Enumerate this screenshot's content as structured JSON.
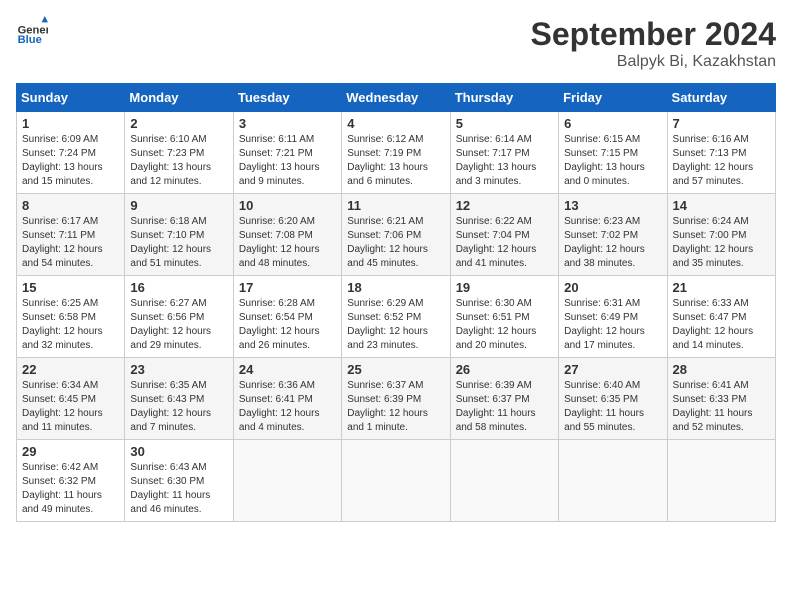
{
  "header": {
    "logo_general": "General",
    "logo_blue": "Blue",
    "month": "September 2024",
    "location": "Balpyk Bi, Kazakhstan"
  },
  "days_of_week": [
    "Sunday",
    "Monday",
    "Tuesday",
    "Wednesday",
    "Thursday",
    "Friday",
    "Saturday"
  ],
  "weeks": [
    [
      {
        "day": 1,
        "sunrise": "6:09 AM",
        "sunset": "7:24 PM",
        "daylight": "13 hours and 15 minutes."
      },
      {
        "day": 2,
        "sunrise": "6:10 AM",
        "sunset": "7:23 PM",
        "daylight": "13 hours and 12 minutes."
      },
      {
        "day": 3,
        "sunrise": "6:11 AM",
        "sunset": "7:21 PM",
        "daylight": "13 hours and 9 minutes."
      },
      {
        "day": 4,
        "sunrise": "6:12 AM",
        "sunset": "7:19 PM",
        "daylight": "13 hours and 6 minutes."
      },
      {
        "day": 5,
        "sunrise": "6:14 AM",
        "sunset": "7:17 PM",
        "daylight": "13 hours and 3 minutes."
      },
      {
        "day": 6,
        "sunrise": "6:15 AM",
        "sunset": "7:15 PM",
        "daylight": "13 hours and 0 minutes."
      },
      {
        "day": 7,
        "sunrise": "6:16 AM",
        "sunset": "7:13 PM",
        "daylight": "12 hours and 57 minutes."
      }
    ],
    [
      {
        "day": 8,
        "sunrise": "6:17 AM",
        "sunset": "7:11 PM",
        "daylight": "12 hours and 54 minutes."
      },
      {
        "day": 9,
        "sunrise": "6:18 AM",
        "sunset": "7:10 PM",
        "daylight": "12 hours and 51 minutes."
      },
      {
        "day": 10,
        "sunrise": "6:20 AM",
        "sunset": "7:08 PM",
        "daylight": "12 hours and 48 minutes."
      },
      {
        "day": 11,
        "sunrise": "6:21 AM",
        "sunset": "7:06 PM",
        "daylight": "12 hours and 45 minutes."
      },
      {
        "day": 12,
        "sunrise": "6:22 AM",
        "sunset": "7:04 PM",
        "daylight": "12 hours and 41 minutes."
      },
      {
        "day": 13,
        "sunrise": "6:23 AM",
        "sunset": "7:02 PM",
        "daylight": "12 hours and 38 minutes."
      },
      {
        "day": 14,
        "sunrise": "6:24 AM",
        "sunset": "7:00 PM",
        "daylight": "12 hours and 35 minutes."
      }
    ],
    [
      {
        "day": 15,
        "sunrise": "6:25 AM",
        "sunset": "6:58 PM",
        "daylight": "12 hours and 32 minutes."
      },
      {
        "day": 16,
        "sunrise": "6:27 AM",
        "sunset": "6:56 PM",
        "daylight": "12 hours and 29 minutes."
      },
      {
        "day": 17,
        "sunrise": "6:28 AM",
        "sunset": "6:54 PM",
        "daylight": "12 hours and 26 minutes."
      },
      {
        "day": 18,
        "sunrise": "6:29 AM",
        "sunset": "6:52 PM",
        "daylight": "12 hours and 23 minutes."
      },
      {
        "day": 19,
        "sunrise": "6:30 AM",
        "sunset": "6:51 PM",
        "daylight": "12 hours and 20 minutes."
      },
      {
        "day": 20,
        "sunrise": "6:31 AM",
        "sunset": "6:49 PM",
        "daylight": "12 hours and 17 minutes."
      },
      {
        "day": 21,
        "sunrise": "6:33 AM",
        "sunset": "6:47 PM",
        "daylight": "12 hours and 14 minutes."
      }
    ],
    [
      {
        "day": 22,
        "sunrise": "6:34 AM",
        "sunset": "6:45 PM",
        "daylight": "12 hours and 11 minutes."
      },
      {
        "day": 23,
        "sunrise": "6:35 AM",
        "sunset": "6:43 PM",
        "daylight": "12 hours and 7 minutes."
      },
      {
        "day": 24,
        "sunrise": "6:36 AM",
        "sunset": "6:41 PM",
        "daylight": "12 hours and 4 minutes."
      },
      {
        "day": 25,
        "sunrise": "6:37 AM",
        "sunset": "6:39 PM",
        "daylight": "12 hours and 1 minute."
      },
      {
        "day": 26,
        "sunrise": "6:39 AM",
        "sunset": "6:37 PM",
        "daylight": "11 hours and 58 minutes."
      },
      {
        "day": 27,
        "sunrise": "6:40 AM",
        "sunset": "6:35 PM",
        "daylight": "11 hours and 55 minutes."
      },
      {
        "day": 28,
        "sunrise": "6:41 AM",
        "sunset": "6:33 PM",
        "daylight": "11 hours and 52 minutes."
      }
    ],
    [
      {
        "day": 29,
        "sunrise": "6:42 AM",
        "sunset": "6:32 PM",
        "daylight": "11 hours and 49 minutes."
      },
      {
        "day": 30,
        "sunrise": "6:43 AM",
        "sunset": "6:30 PM",
        "daylight": "11 hours and 46 minutes."
      },
      null,
      null,
      null,
      null,
      null
    ]
  ]
}
